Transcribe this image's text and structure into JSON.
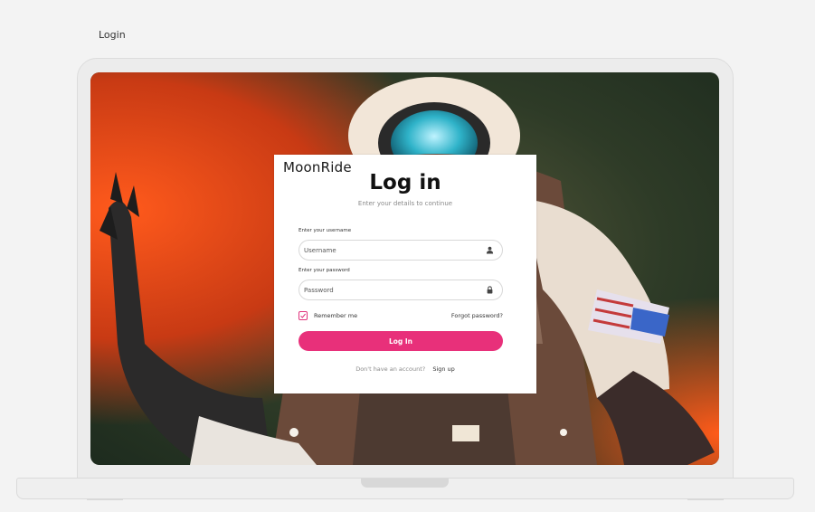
{
  "page": {
    "title": "Login"
  },
  "login_card": {
    "brand": "MoonRide",
    "heading": "Log in",
    "subheading": "Enter your details to continue",
    "username": {
      "label": "Enter your username",
      "placeholder": "Username",
      "value": "",
      "icon": "user-icon"
    },
    "password": {
      "label": "Enter your password",
      "placeholder": "Password",
      "value": "",
      "icon": "lock-icon"
    },
    "remember_me": {
      "label": "Remember me",
      "checked": true
    },
    "forgot_password": "Forgot password?",
    "submit_label": "Log In",
    "signup_prompt": "Don't have an account?",
    "signup_link": "Sign up"
  },
  "colors": {
    "accent": "#e8307a",
    "background": "#f3f3f3",
    "card": "#ffffff"
  },
  "background_image": {
    "subject": "astronaut-photo",
    "icon": "astronaut-illustration"
  }
}
